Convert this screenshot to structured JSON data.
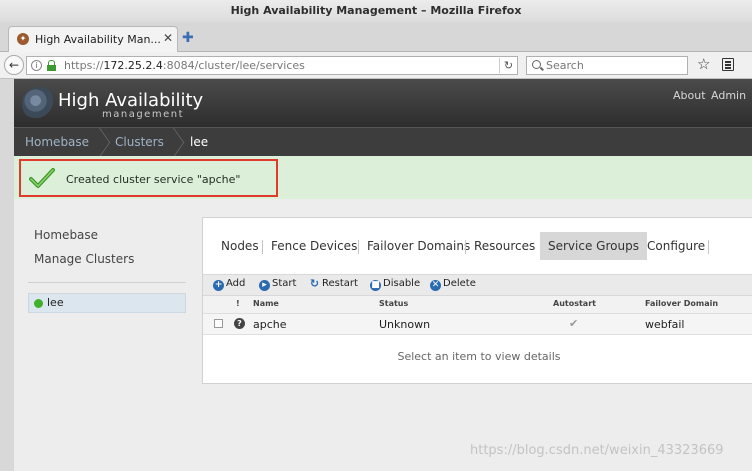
{
  "window": {
    "title": "High Availability Management – Mozilla Firefox"
  },
  "browser": {
    "tab_title": "High Availability Man...",
    "url_base": "https://",
    "url_host": "172.25.2.4",
    "url_rest": ":8084/cluster/lee/services",
    "search_placeholder": "Search"
  },
  "app": {
    "title": "High Availability",
    "subtitle": "management",
    "header_links": [
      "About",
      "Admin"
    ]
  },
  "breadcrumb": [
    "Homebase",
    "Clusters",
    "lee"
  ],
  "notice": {
    "text": "Created cluster service \"apche\""
  },
  "sidebar": {
    "links": [
      "Homebase",
      "Manage Clusters"
    ],
    "cluster": {
      "name": "lee",
      "status_color": "#3fb12a"
    }
  },
  "tabs": [
    "Nodes",
    "Fence Devices",
    "Failover Domains",
    "Resources",
    "Service Groups",
    "Configure"
  ],
  "active_tab": "Service Groups",
  "toolbar": {
    "add": "Add",
    "start": "Start",
    "restart": "Restart",
    "disable": "Disable",
    "delete": "Delete"
  },
  "table": {
    "headers": {
      "flag": "!",
      "name": "Name",
      "status": "Status",
      "autostart": "Autostart",
      "domain": "Failover Domain"
    },
    "rows": [
      {
        "name": "apche",
        "status": "Unknown",
        "autostart": true,
        "domain": "webfail"
      }
    ]
  },
  "details_placeholder": "Select an item to view details",
  "watermark": "https://blog.csdn.net/weixin_43323669"
}
